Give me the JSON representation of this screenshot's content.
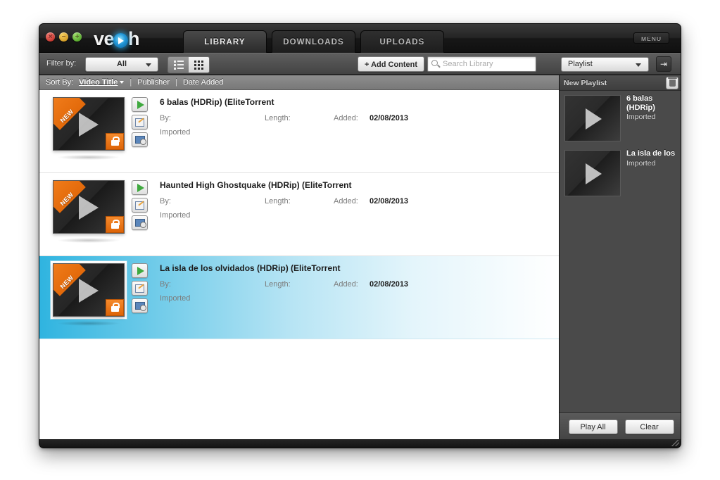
{
  "window": {
    "logo_text_left": "ve",
    "logo_text_right": "h",
    "menu_label": "MENU",
    "traffic_lights": [
      "close",
      "minimize",
      "zoom"
    ]
  },
  "tabs": [
    {
      "label": "LIBRARY",
      "active": true
    },
    {
      "label": "DOWNLOADS",
      "active": false
    },
    {
      "label": "UPLOADS",
      "active": false
    }
  ],
  "toolbar": {
    "filter_label": "Filter by:",
    "filter_value": "All",
    "view_list_icon": "list-view-icon",
    "view_grid_icon": "grid-view-icon",
    "add_content_label": "+ Add Content",
    "search_placeholder": "Search Library",
    "search_value": "",
    "playlist_select_value": "Playlist",
    "panel_toggle_icon": "panel-collapse-icon"
  },
  "sortbar": {
    "label": "Sort By:",
    "options": [
      {
        "label": "Video Title",
        "active": true
      },
      {
        "label": "Publisher",
        "active": false
      },
      {
        "label": "Date Added",
        "active": false
      }
    ],
    "separator": "|"
  },
  "library": {
    "meta_labels": {
      "by": "By:",
      "length": "Length:",
      "added": "Added:"
    },
    "badge_new": "NEW",
    "rows": [
      {
        "title": "6 balas (HDRip) (EliteTorrent",
        "by": "",
        "length": "",
        "added": "02/08/2013",
        "source": "Imported",
        "selected": false,
        "badge": "NEW",
        "locked": true
      },
      {
        "title": "Haunted High Ghostquake (HDRip) (EliteTorrent",
        "by": "",
        "length": "",
        "added": "02/08/2013",
        "source": "Imported",
        "selected": false,
        "badge": "NEW",
        "locked": true
      },
      {
        "title": "La isla de los olvidados (HDRip) (EliteTorrent",
        "by": "",
        "length": "",
        "added": "02/08/2013",
        "source": "Imported",
        "selected": true,
        "badge": "NEW",
        "locked": true
      }
    ]
  },
  "playlist": {
    "header_name": "New Playlist",
    "trash_icon": "trash-icon",
    "items": [
      {
        "title": "6 balas (HDRip)",
        "subtitle": "Imported"
      },
      {
        "title": "La isla de los",
        "subtitle": "Imported"
      }
    ],
    "play_all_label": "Play All",
    "clear_label": "Clear"
  },
  "colors": {
    "accent_blue": "#2fb4e0",
    "badge_orange": "#f58220",
    "play_green": "#3fa93f",
    "chrome_dark": "#1b1b1b"
  }
}
